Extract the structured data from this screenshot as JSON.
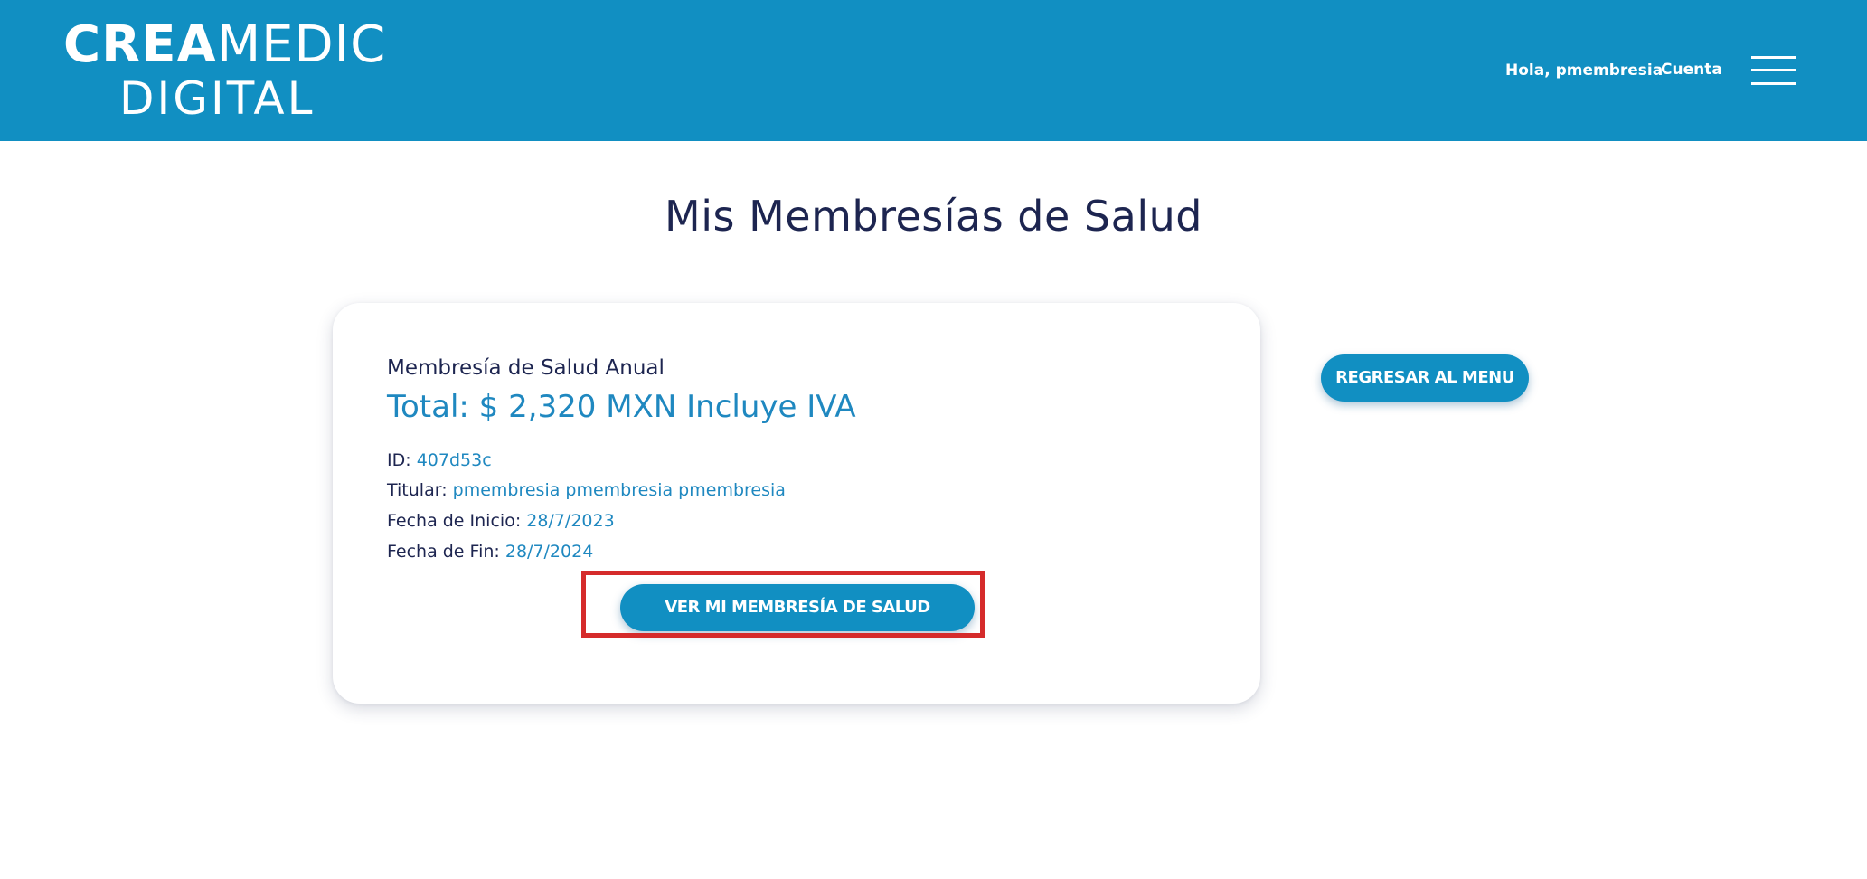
{
  "header": {
    "logo_line1_part1": "CREA",
    "logo_line1_part2": "MEDIC",
    "logo_line2": "DIGITAL",
    "greeting": "Hola, pmembresia",
    "account_label": "Cuenta",
    "menu_icon": "hamburger-menu-icon",
    "background_color": "#118fc2"
  },
  "main": {
    "title": "Mis Membresías de Salud",
    "back_button_label": "REGRESAR AL MENU"
  },
  "membership": {
    "type": "Membresía de Salud Anual",
    "total": "Total: $ 2,320 MXN Incluye IVA",
    "id_label": "ID:",
    "id_value": "407d53c",
    "holder_label": "Titular:",
    "holder_value": "pmembresia pmembresia pmembresia",
    "start_label": "Fecha de Inicio:",
    "start_value": "28/7/2023",
    "end_label": "Fecha de Fin:",
    "end_value": "28/7/2024",
    "view_button_label": "VER MI MEMBRESÍA DE SALUD"
  },
  "colors": {
    "accent": "#118fc2",
    "title_text": "#1d2550",
    "value_text": "#1f88c0",
    "highlight_border": "#d52b2b"
  }
}
